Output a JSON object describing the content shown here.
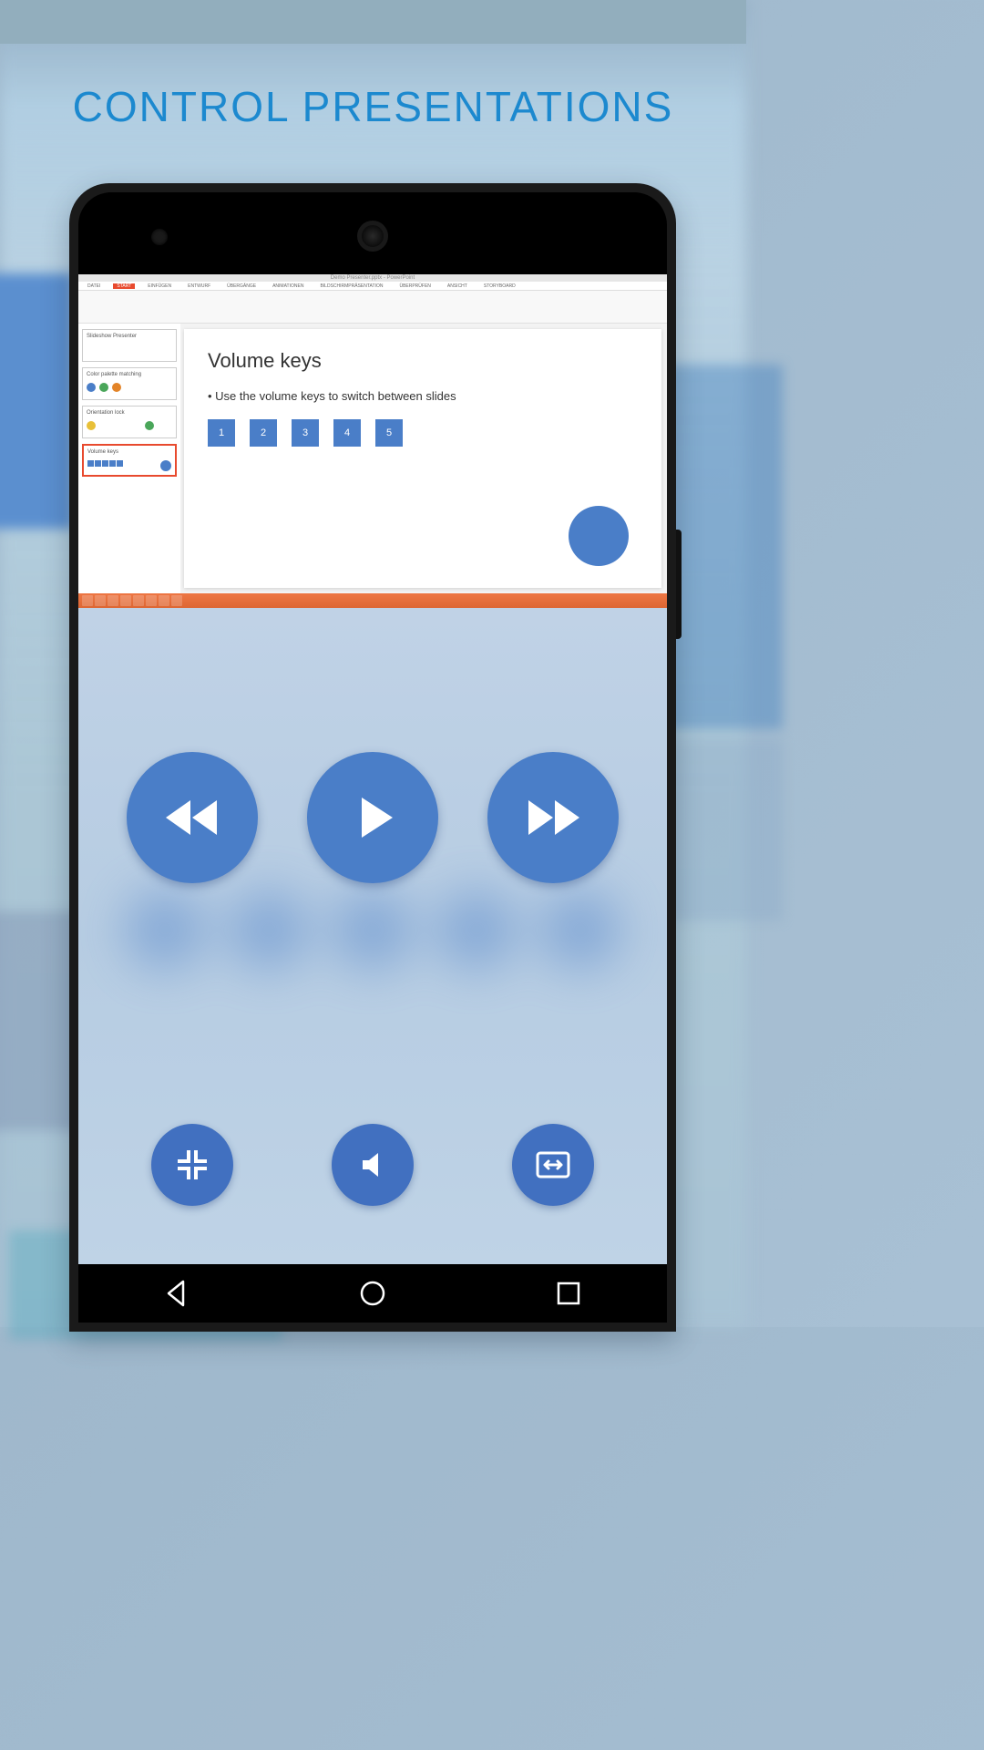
{
  "title": "CONTROL PRESENTATIONS",
  "colors": {
    "accent": "#1c89cf",
    "primaryButton": "#4a7ec8",
    "secondaryButton": "#4170c0"
  },
  "powerpoint": {
    "windowTitle": "Demo Presenter.pptx - PowerPoint",
    "ribbonTabs": [
      "DATEI",
      "START",
      "EINFÜGEN",
      "ENTWURF",
      "ÜBERGÄNGE",
      "ANIMATIONEN",
      "BILDSCHIRMPRÄSENTATION",
      "ÜBERPRÜFEN",
      "ANSICHT",
      "STORYBOARD"
    ],
    "activeTab": "START",
    "thumbnails": [
      {
        "title": "Slideshow Presenter"
      },
      {
        "title": "Color palette matching"
      },
      {
        "title": "Orientation lock"
      },
      {
        "title": "Volume keys"
      }
    ],
    "activeSlide": 4,
    "slide": {
      "heading": "Volume keys",
      "bullet": "• Use the volume keys to switch between slides",
      "blocks": [
        "1",
        "2",
        "3",
        "4",
        "5"
      ]
    }
  },
  "controls": {
    "main": [
      {
        "name": "previous-button",
        "icon": "rewind-icon"
      },
      {
        "name": "play-button",
        "icon": "play-icon"
      },
      {
        "name": "next-button",
        "icon": "fast-forward-icon"
      }
    ],
    "secondary": [
      {
        "name": "fullscreen-exit-button",
        "icon": "fullscreen-exit-icon"
      },
      {
        "name": "volume-button",
        "icon": "volume-icon"
      },
      {
        "name": "swap-screen-button",
        "icon": "swap-screen-icon"
      }
    ]
  },
  "navbar": [
    "back-nav",
    "home-nav",
    "recents-nav"
  ]
}
